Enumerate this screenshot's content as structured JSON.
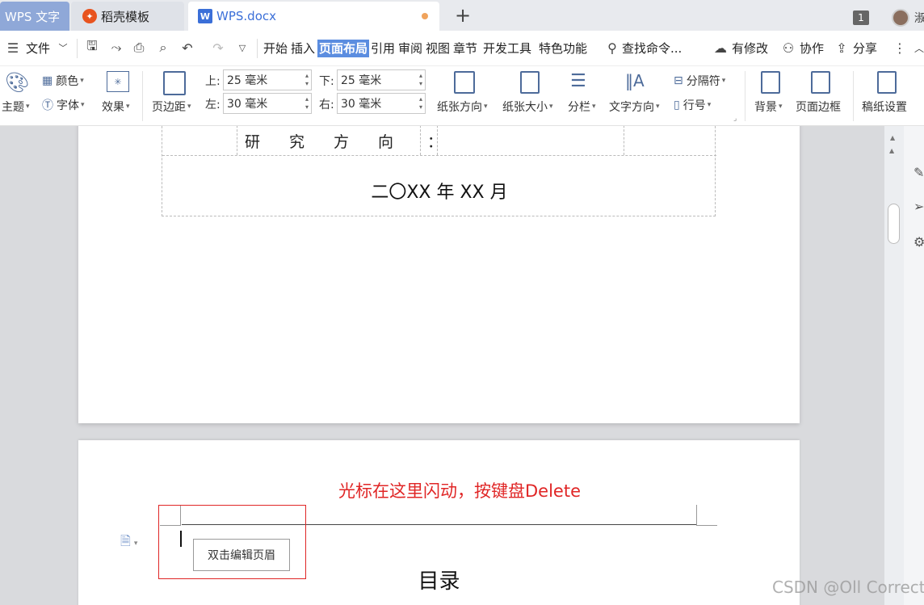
{
  "tabs": {
    "wps": "WPS 文字",
    "daoke": "稻壳模板",
    "doc": "WPS.docx",
    "new": "+"
  },
  "topright": {
    "badge": "1",
    "user_initial": "淑"
  },
  "menu": {
    "file": "文件",
    "items": [
      "开始",
      "插入",
      "页面布局",
      "引用",
      "审阅",
      "视图",
      "章节",
      "开发工具",
      "特色功能"
    ],
    "active_index": 2,
    "search": "查找命令...",
    "modified": "有修改",
    "collab": "协作",
    "share": "分享"
  },
  "ribbon": {
    "theme": "主题",
    "color": "颜色",
    "font": "字体",
    "effect": "效果",
    "margin": "页边距",
    "top_label": "上:",
    "bottom_label": "下:",
    "left_label": "左:",
    "right_label": "右:",
    "top_value": "25 毫米",
    "bottom_value": "25 毫米",
    "left_value": "30 毫米",
    "right_value": "30 毫米",
    "orientation": "纸张方向",
    "size": "纸张大小",
    "columns": "分栏",
    "text_direction": "文字方向",
    "separator": "分隔符",
    "line_number": "行号",
    "background": "背景",
    "page_border": "页面边框",
    "manuscript": "稿纸设置"
  },
  "page1": {
    "research_label": "研究方向",
    "colon": "：",
    "date": "二〇XX 年 XX 月"
  },
  "page2": {
    "annotation": "光标在这里闪动，按键盘Delete",
    "tooltip": "双击编辑页眉",
    "toc_title": "目录"
  },
  "watermark": "CSDN @Oll Correct",
  "colors": {
    "accent": "#5b8de0",
    "annotation_red": "#e02626",
    "tab_dot": "#f0a35c"
  }
}
